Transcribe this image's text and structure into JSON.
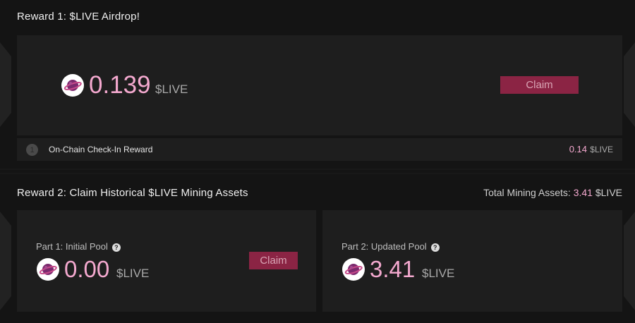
{
  "reward1": {
    "title": "Reward 1: $LIVE Airdrop!",
    "amount": "0.139",
    "unit": "$LIVE",
    "claim_label": "Claim",
    "checkin": {
      "index": "1",
      "label": "On-Chain Check-In Reward",
      "amount": "0.14",
      "unit": "$LIVE"
    }
  },
  "reward2": {
    "title": "Reward 2: Claim Historical $LIVE Mining Assets",
    "total_label": "Total Mining Assets:",
    "total_amount": "3.41",
    "total_unit": "$LIVE",
    "part1": {
      "label": "Part 1: Initial Pool",
      "amount": "0.00",
      "unit": "$LIVE",
      "claim_label": "Claim"
    },
    "part2": {
      "label": "Part 2: Updated Pool",
      "amount": "3.41",
      "unit": "$LIVE"
    }
  },
  "icons": {
    "coin": "planet-coin-icon",
    "help": "question-circle-icon"
  },
  "colors": {
    "accent_pink": "#f4a9cf",
    "claim_button": "#8b2444",
    "panel": "#1e1e1e",
    "background": "#141414"
  }
}
